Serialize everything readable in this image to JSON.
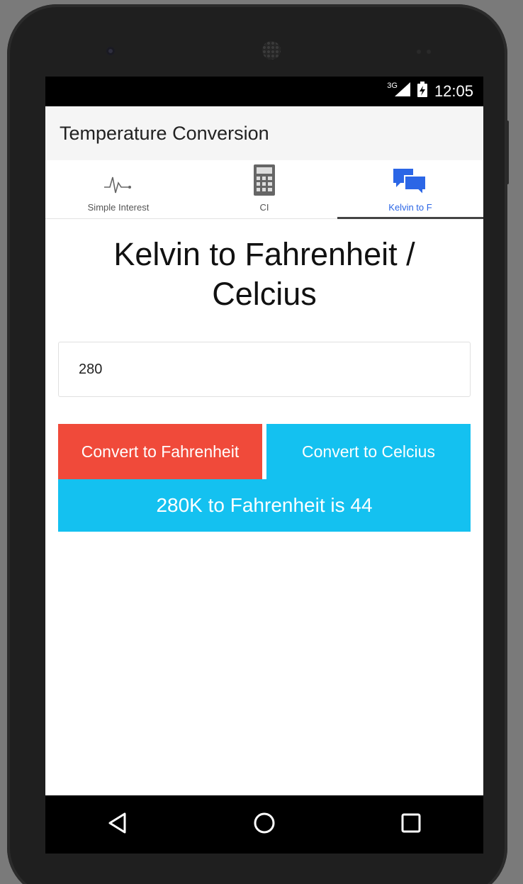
{
  "status_bar": {
    "network": "3G",
    "time": "12:05"
  },
  "app_bar": {
    "title": "Temperature Conversion"
  },
  "tabs": [
    {
      "label": "Simple Interest",
      "icon": "pulse-icon",
      "active": false
    },
    {
      "label": "CI",
      "icon": "calculator-icon",
      "active": false
    },
    {
      "label": "Kelvin to F",
      "icon": "chat-bubbles-icon",
      "active": true
    }
  ],
  "main": {
    "heading": "Kelvin to Fahrenheit / Celcius",
    "input_value": "280",
    "buttons": {
      "to_fahrenheit": "Convert to Fahrenheit",
      "to_celcius": "Convert to Celcius"
    },
    "result": "280K to Fahrenheit is 44"
  },
  "colors": {
    "red_button": "#f04a3a",
    "blue_button": "#14c1f0",
    "active_tab": "#2b66e6"
  }
}
